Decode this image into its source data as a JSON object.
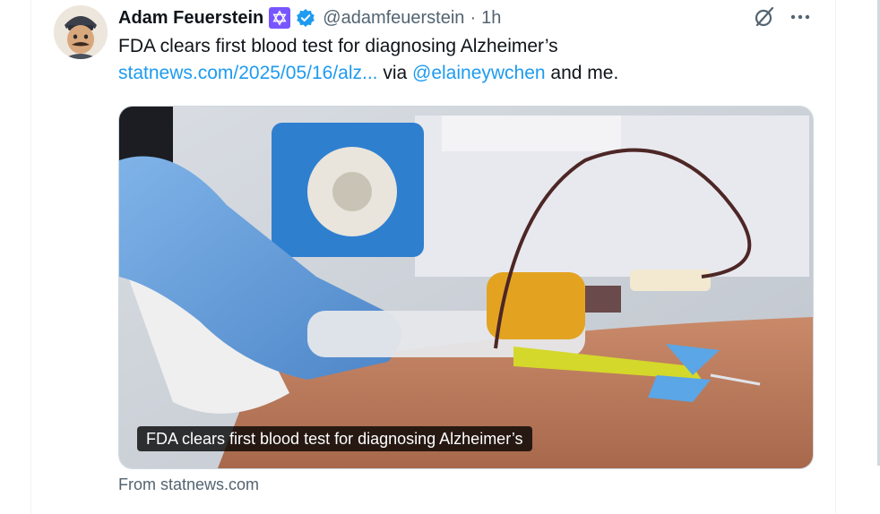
{
  "tweet": {
    "author_name": "Adam Feuerstein",
    "handle": "@adamfeuerstein",
    "separator": "·",
    "timestamp": "1h",
    "text_line1": "FDA clears first blood test for diagnosing Alzheimer’s",
    "link_text": "statnews.com/2025/05/16/alz...",
    "via_text": " via ",
    "mention": "@elaineywchen",
    "suffix_text": " and me."
  },
  "card": {
    "caption": "FDA clears first blood test for diagnosing Alzheimer’s",
    "source": "From statnews.com"
  },
  "icons": {
    "avatar": "cartoon-avatar",
    "badge1": "star-of-david-badge",
    "badge2": "verified-checkmark-icon",
    "grok": "grok-icon",
    "more": "more-dots-icon"
  },
  "colors": {
    "link": "#1d9bf0",
    "secondary_text": "#536471",
    "badge_purple": "#7856ff",
    "verified_blue": "#1d9bf0"
  }
}
